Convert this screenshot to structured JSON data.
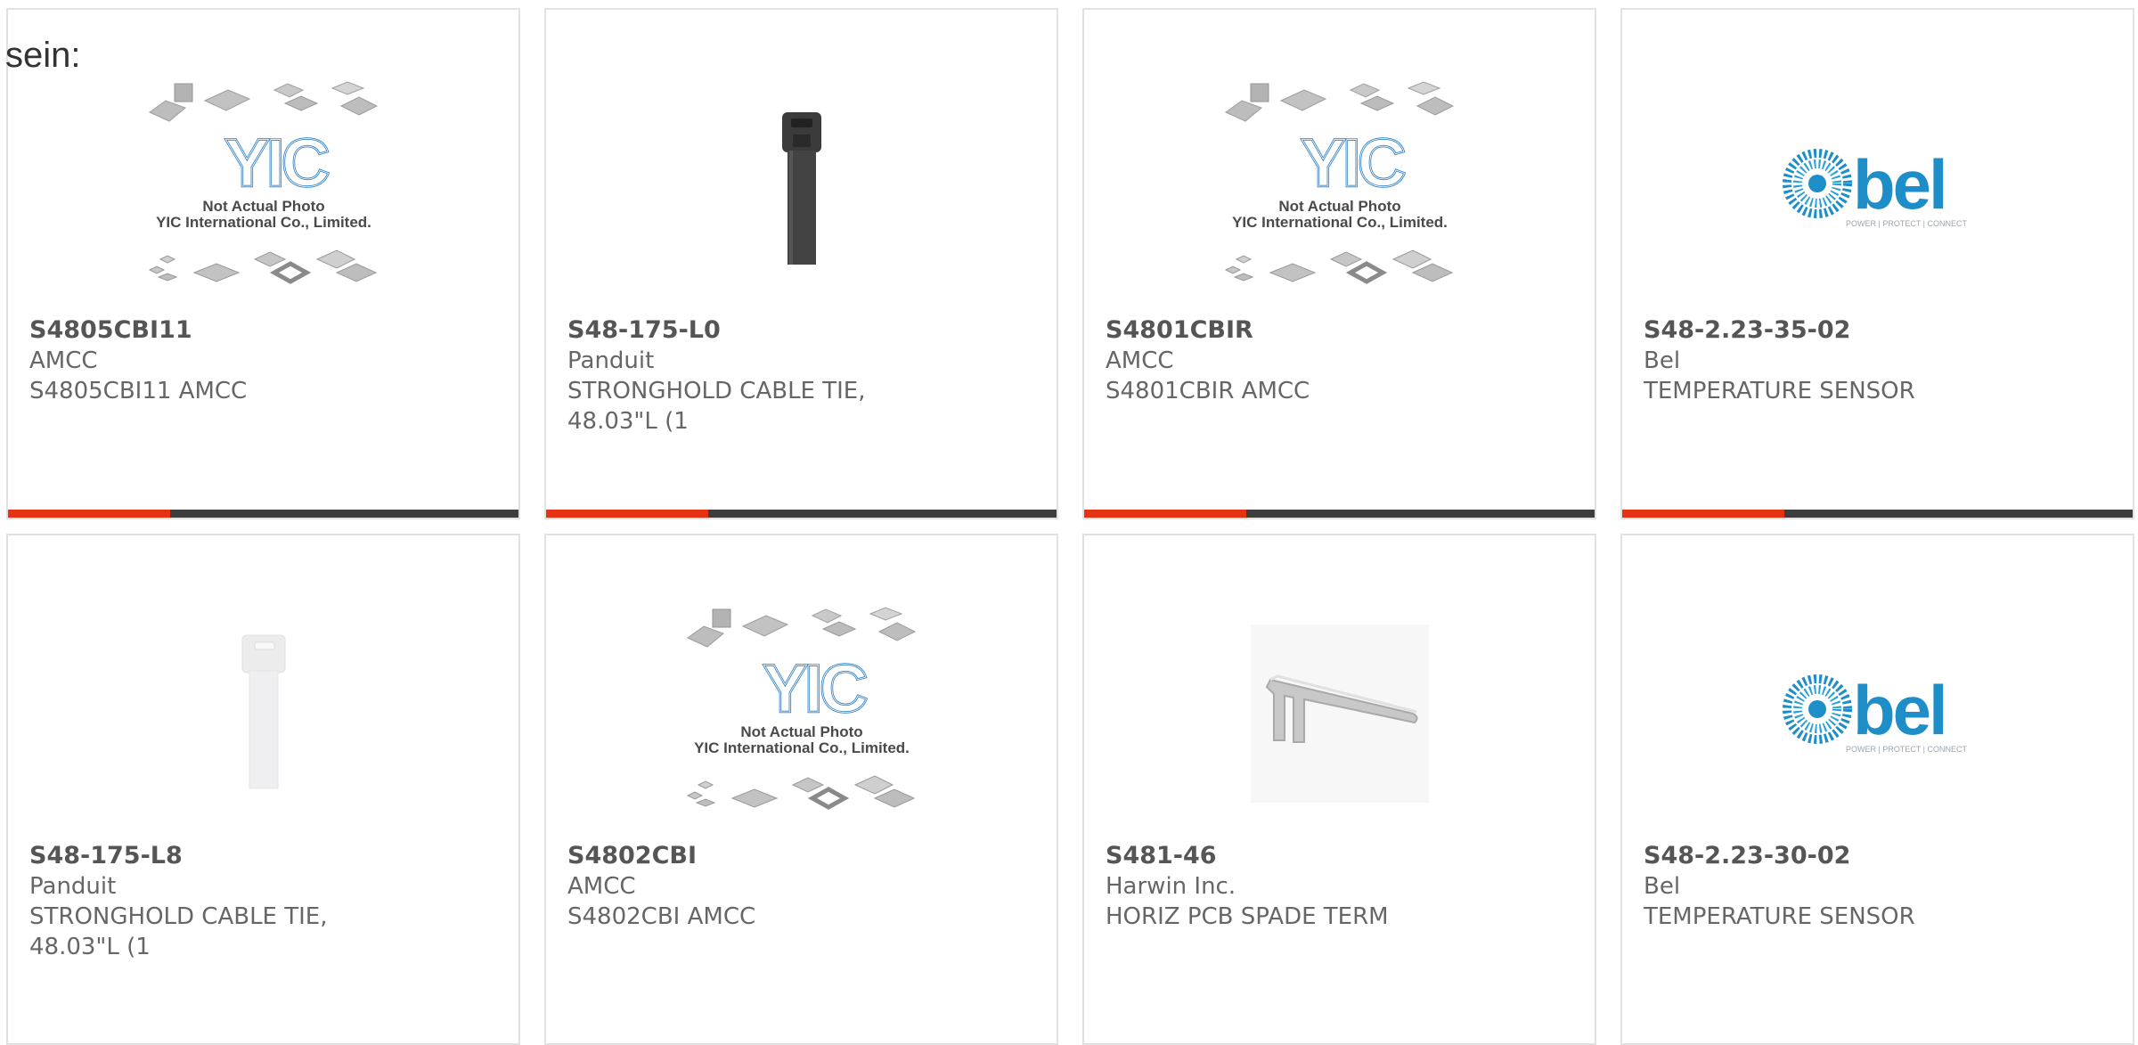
{
  "header": {
    "fragment": "sein:"
  },
  "colors": {
    "accent": "#e53212",
    "bar": "#3d3d3d",
    "yic_blue": "#2f7fc4",
    "bel_blue": "#1e8ec9"
  },
  "placeholder": {
    "line1": "Not Actual Photo",
    "line2": "YIC International Co., Limited.",
    "logo": "YIC"
  },
  "bel_logo": {
    "text": "bel",
    "tagline": "POWER | PROTECT | CONNECT"
  },
  "cards": [
    {
      "part": "S4805CBI11",
      "brand": "AMCC",
      "desc": "S4805CBI11 AMCC",
      "image": "placeholder-chips"
    },
    {
      "part": "S48-175-L0",
      "brand": "Panduit",
      "desc": "STRONGHOLD CABLE TIE,\n48.03\"L (1",
      "image": "cable-tie-black"
    },
    {
      "part": "S4801CBIR",
      "brand": "AMCC",
      "desc": "S4801CBIR AMCC",
      "image": "placeholder-chips"
    },
    {
      "part": "S48-2.23-35-02",
      "brand": "Bel",
      "desc": "TEMPERATURE SENSOR",
      "image": "bel-logo"
    },
    {
      "part": "S48-175-L8",
      "brand": "Panduit",
      "desc": "STRONGHOLD CABLE TIE,\n48.03\"L (1",
      "image": "cable-tie-white"
    },
    {
      "part": "S4802CBI",
      "brand": "AMCC",
      "desc": "S4802CBI AMCC",
      "image": "placeholder-chips"
    },
    {
      "part": "S481-46",
      "brand": "Harwin Inc.",
      "desc": "HORIZ PCB SPADE TERM",
      "image": "spade-terminal"
    },
    {
      "part": "S48-2.23-30-02",
      "brand": "Bel",
      "desc": "TEMPERATURE SENSOR",
      "image": "bel-logo"
    }
  ]
}
